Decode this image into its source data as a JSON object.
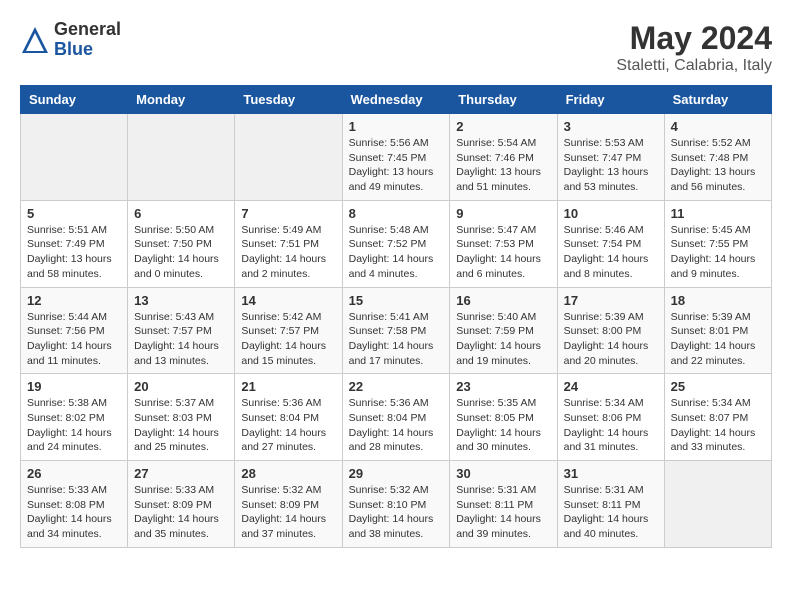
{
  "logo": {
    "general": "General",
    "blue": "Blue"
  },
  "header": {
    "month_year": "May 2024",
    "location": "Staletti, Calabria, Italy"
  },
  "days_of_week": [
    "Sunday",
    "Monday",
    "Tuesday",
    "Wednesday",
    "Thursday",
    "Friday",
    "Saturday"
  ],
  "weeks": [
    [
      {
        "day": "",
        "info": ""
      },
      {
        "day": "",
        "info": ""
      },
      {
        "day": "",
        "info": ""
      },
      {
        "day": "1",
        "info": "Sunrise: 5:56 AM\nSunset: 7:45 PM\nDaylight: 13 hours\nand 49 minutes."
      },
      {
        "day": "2",
        "info": "Sunrise: 5:54 AM\nSunset: 7:46 PM\nDaylight: 13 hours\nand 51 minutes."
      },
      {
        "day": "3",
        "info": "Sunrise: 5:53 AM\nSunset: 7:47 PM\nDaylight: 13 hours\nand 53 minutes."
      },
      {
        "day": "4",
        "info": "Sunrise: 5:52 AM\nSunset: 7:48 PM\nDaylight: 13 hours\nand 56 minutes."
      }
    ],
    [
      {
        "day": "5",
        "info": "Sunrise: 5:51 AM\nSunset: 7:49 PM\nDaylight: 13 hours\nand 58 minutes."
      },
      {
        "day": "6",
        "info": "Sunrise: 5:50 AM\nSunset: 7:50 PM\nDaylight: 14 hours\nand 0 minutes."
      },
      {
        "day": "7",
        "info": "Sunrise: 5:49 AM\nSunset: 7:51 PM\nDaylight: 14 hours\nand 2 minutes."
      },
      {
        "day": "8",
        "info": "Sunrise: 5:48 AM\nSunset: 7:52 PM\nDaylight: 14 hours\nand 4 minutes."
      },
      {
        "day": "9",
        "info": "Sunrise: 5:47 AM\nSunset: 7:53 PM\nDaylight: 14 hours\nand 6 minutes."
      },
      {
        "day": "10",
        "info": "Sunrise: 5:46 AM\nSunset: 7:54 PM\nDaylight: 14 hours\nand 8 minutes."
      },
      {
        "day": "11",
        "info": "Sunrise: 5:45 AM\nSunset: 7:55 PM\nDaylight: 14 hours\nand 9 minutes."
      }
    ],
    [
      {
        "day": "12",
        "info": "Sunrise: 5:44 AM\nSunset: 7:56 PM\nDaylight: 14 hours\nand 11 minutes."
      },
      {
        "day": "13",
        "info": "Sunrise: 5:43 AM\nSunset: 7:57 PM\nDaylight: 14 hours\nand 13 minutes."
      },
      {
        "day": "14",
        "info": "Sunrise: 5:42 AM\nSunset: 7:57 PM\nDaylight: 14 hours\nand 15 minutes."
      },
      {
        "day": "15",
        "info": "Sunrise: 5:41 AM\nSunset: 7:58 PM\nDaylight: 14 hours\nand 17 minutes."
      },
      {
        "day": "16",
        "info": "Sunrise: 5:40 AM\nSunset: 7:59 PM\nDaylight: 14 hours\nand 19 minutes."
      },
      {
        "day": "17",
        "info": "Sunrise: 5:39 AM\nSunset: 8:00 PM\nDaylight: 14 hours\nand 20 minutes."
      },
      {
        "day": "18",
        "info": "Sunrise: 5:39 AM\nSunset: 8:01 PM\nDaylight: 14 hours\nand 22 minutes."
      }
    ],
    [
      {
        "day": "19",
        "info": "Sunrise: 5:38 AM\nSunset: 8:02 PM\nDaylight: 14 hours\nand 24 minutes."
      },
      {
        "day": "20",
        "info": "Sunrise: 5:37 AM\nSunset: 8:03 PM\nDaylight: 14 hours\nand 25 minutes."
      },
      {
        "day": "21",
        "info": "Sunrise: 5:36 AM\nSunset: 8:04 PM\nDaylight: 14 hours\nand 27 minutes."
      },
      {
        "day": "22",
        "info": "Sunrise: 5:36 AM\nSunset: 8:04 PM\nDaylight: 14 hours\nand 28 minutes."
      },
      {
        "day": "23",
        "info": "Sunrise: 5:35 AM\nSunset: 8:05 PM\nDaylight: 14 hours\nand 30 minutes."
      },
      {
        "day": "24",
        "info": "Sunrise: 5:34 AM\nSunset: 8:06 PM\nDaylight: 14 hours\nand 31 minutes."
      },
      {
        "day": "25",
        "info": "Sunrise: 5:34 AM\nSunset: 8:07 PM\nDaylight: 14 hours\nand 33 minutes."
      }
    ],
    [
      {
        "day": "26",
        "info": "Sunrise: 5:33 AM\nSunset: 8:08 PM\nDaylight: 14 hours\nand 34 minutes."
      },
      {
        "day": "27",
        "info": "Sunrise: 5:33 AM\nSunset: 8:09 PM\nDaylight: 14 hours\nand 35 minutes."
      },
      {
        "day": "28",
        "info": "Sunrise: 5:32 AM\nSunset: 8:09 PM\nDaylight: 14 hours\nand 37 minutes."
      },
      {
        "day": "29",
        "info": "Sunrise: 5:32 AM\nSunset: 8:10 PM\nDaylight: 14 hours\nand 38 minutes."
      },
      {
        "day": "30",
        "info": "Sunrise: 5:31 AM\nSunset: 8:11 PM\nDaylight: 14 hours\nand 39 minutes."
      },
      {
        "day": "31",
        "info": "Sunrise: 5:31 AM\nSunset: 8:11 PM\nDaylight: 14 hours\nand 40 minutes."
      },
      {
        "day": "",
        "info": ""
      }
    ]
  ]
}
